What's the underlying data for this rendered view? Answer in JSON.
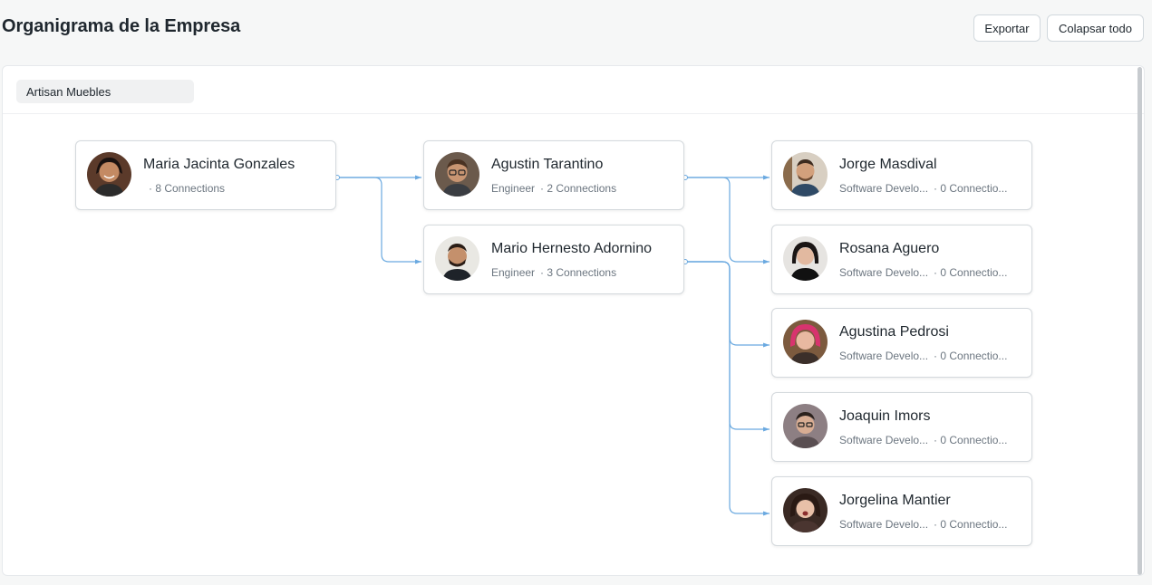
{
  "header": {
    "title": "Organigrama de la Empresa",
    "export_label": "Exportar",
    "collapse_label": "Colapsar todo"
  },
  "company": {
    "selected": "Artisan Muebles"
  },
  "colors": {
    "link": "#6aa9e0",
    "accent": "#1f272e"
  },
  "nodes": [
    {
      "name": "Maria Jacinta Gonzales",
      "role": "",
      "connections": "· 8 Connections",
      "avatar_icon": "female-avatar-photo"
    },
    {
      "name": "Agustin Tarantino",
      "role": "Engineer",
      "connections": "· 2 Connections",
      "avatar_icon": "male-avatar-photo"
    },
    {
      "name": "Mario Hernesto Adornino",
      "role": "Engineer",
      "connections": "· 3 Connections",
      "avatar_icon": "male-avatar-photo"
    },
    {
      "name": "Jorge Masdival",
      "role": "Software Develo...",
      "connections": "· 0 Connectio...",
      "avatar_icon": "male-avatar-photo"
    },
    {
      "name": "Rosana Aguero",
      "role": "Software Develo...",
      "connections": "· 0 Connectio...",
      "avatar_icon": "female-avatar-photo"
    },
    {
      "name": "Agustina Pedrosi",
      "role": "Software Develo...",
      "connections": "· 0 Connectio...",
      "avatar_icon": "female-avatar-photo"
    },
    {
      "name": "Joaquin Imors",
      "role": "Software Develo...",
      "connections": "· 0 Connectio...",
      "avatar_icon": "male-avatar-photo"
    },
    {
      "name": "Jorgelina Mantier",
      "role": "Software Develo...",
      "connections": "· 0 Connectio...",
      "avatar_icon": "female-avatar-photo"
    }
  ]
}
